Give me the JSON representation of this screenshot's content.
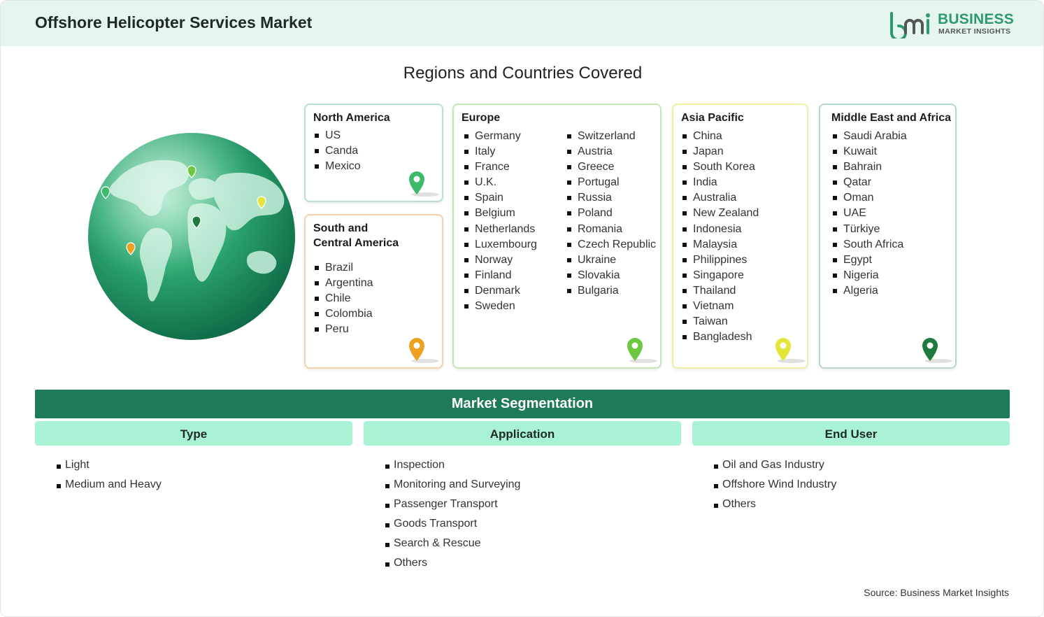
{
  "header": {
    "title": "Offshore Helicopter Services Market",
    "logo": {
      "line1": "BUSINESS",
      "line2": "MARKET INSIGHTS",
      "color": "#2e9a6b"
    }
  },
  "regions_title": "Regions and Countries Covered",
  "regions": {
    "north_america": {
      "title": "North America",
      "items": [
        "US",
        "Canda",
        "Mexico"
      ],
      "pin_color": "#3dbb6a"
    },
    "south_america": {
      "title_line1": "South and",
      "title_line2": "Central America",
      "items": [
        "Brazil",
        "Argentina",
        "Chile",
        "Colombia",
        "Peru"
      ],
      "pin_color": "#f0a020"
    },
    "europe": {
      "title": "Europe",
      "col1": [
        "Germany",
        "Italy",
        "France",
        "U.K.",
        "Spain",
        "Belgium",
        "Netherlands",
        "Luxembourg",
        "Norway",
        "Finland",
        "Denmark",
        "Sweden"
      ],
      "col2": [
        "Switzerland",
        "Austria",
        "Greece",
        "Portugal",
        "Russia",
        "Poland",
        "Romania",
        "Czech Republic",
        "Ukraine",
        "Slovakia",
        "Bulgaria"
      ],
      "pin_color": "#6cc83f"
    },
    "asia_pacific": {
      "title": "Asia Pacific",
      "items": [
        "China",
        "Japan",
        "South Korea",
        "India",
        "Australia",
        "New Zealand",
        "Indonesia",
        "Malaysia",
        "Philippines",
        "Singapore",
        "Thailand",
        "Vietnam",
        "Taiwan",
        "Bangladesh"
      ],
      "pin_color": "#e4e43a"
    },
    "middle_east_africa": {
      "title": "Middle East and Africa",
      "items": [
        "Saudi Arabia",
        "Kuwait",
        "Bahrain",
        "Qatar",
        "Oman",
        "UAE",
        "Türkiye",
        "South Africa",
        "Egypt",
        "Nigeria",
        "Algeria"
      ],
      "pin_color": "#1e7a3f"
    }
  },
  "segmentation": {
    "title": "Market Segmentation",
    "columns": [
      {
        "heading": "Type",
        "items": [
          "Light",
          "Medium and Heavy"
        ]
      },
      {
        "heading": "Application",
        "items": [
          "Inspection",
          "Monitoring and Surveying",
          "Passenger Transport",
          "Goods Transport",
          "Search & Rescue",
          "Others"
        ]
      },
      {
        "heading": "End User",
        "items": [
          "Oil and Gas Industry",
          "Offshore Wind Industry",
          "Others"
        ]
      }
    ]
  },
  "source": "Source: Business Market Insights",
  "colors": {
    "header_bg": "#e7f5ef",
    "segment_bar": "#1e7a57",
    "segment_heading_bg": "#a9f3d4"
  }
}
